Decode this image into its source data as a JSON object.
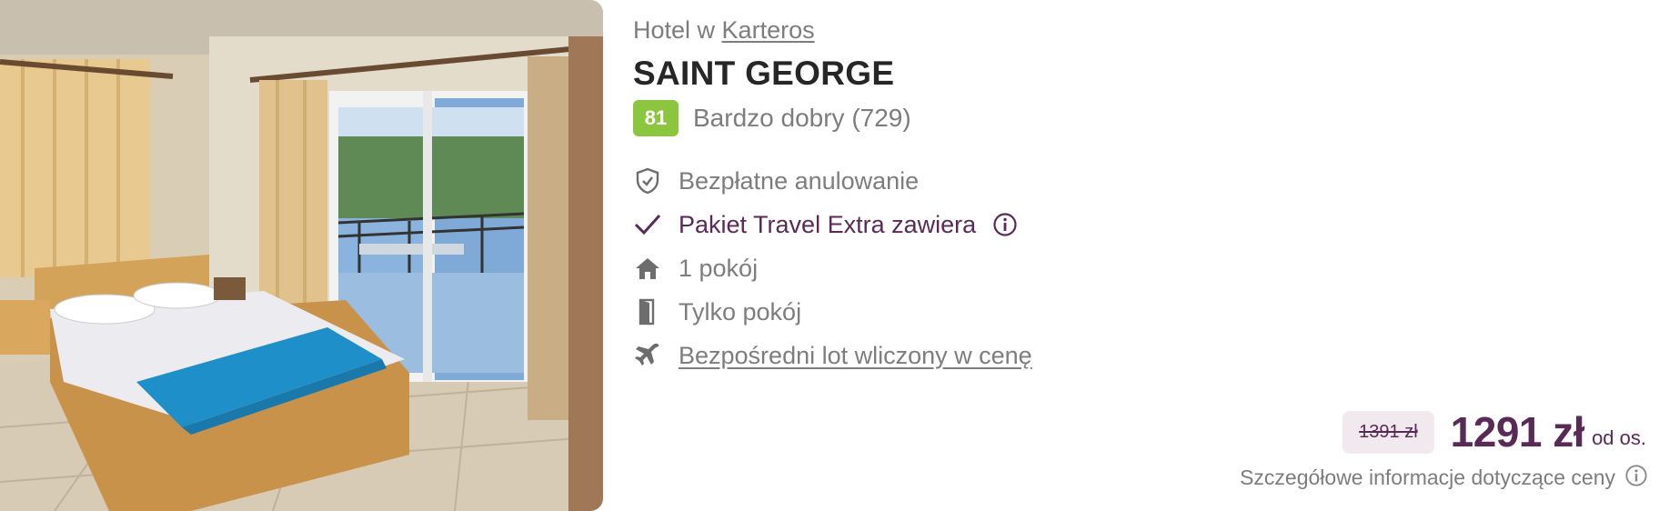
{
  "hotel": {
    "location_prefix": "Hotel w",
    "location": "Karteros",
    "name": "SAINT GEORGE",
    "score": "81",
    "rating_text": "Bardzo dobry (729)"
  },
  "features": [
    {
      "label": "Bezpłatne anulowanie",
      "icon": "shield-check-icon"
    },
    {
      "label": "Pakiet Travel Extra zawiera",
      "icon": "checkmark-icon",
      "info_icon": "info-icon"
    },
    {
      "label": "1 pokój",
      "icon": "house-icon"
    },
    {
      "label": "Tylko pokój",
      "icon": "door-icon"
    },
    {
      "label": "Bezpośredni lot wliczony w cenę",
      "icon": "plane-icon"
    }
  ],
  "price": {
    "old": "1391 zł",
    "current": "1291 zł",
    "per": "od os.",
    "details_label": "Szczegółowe informacje dotyczące ceny"
  },
  "colors": {
    "accent": "#5a2a57",
    "score_badge": "#8cc63f",
    "muted_text": "#7d7d7d"
  }
}
